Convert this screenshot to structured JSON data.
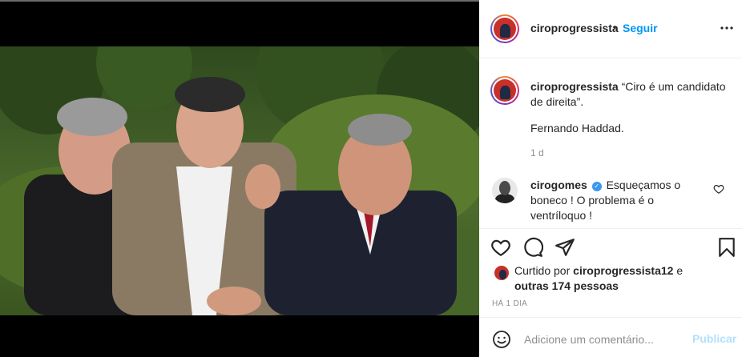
{
  "post": {
    "username": "ciroprogressista",
    "separator": "•",
    "follow_label": "Seguir",
    "more_label": "•••"
  },
  "caption": {
    "username": "ciroprogressista",
    "text": "“Ciro é um candidato de direita”.",
    "line2": "Fernando Haddad.",
    "time": "1 d"
  },
  "comment": {
    "username": "cirogomes",
    "text": "Esqueçamos o boneco ! O problema é o ventríloquo !"
  },
  "likes": {
    "prefix": "Curtido por ",
    "user": "ciroprogressista12",
    "middle": " e",
    "others": "outras 174 pessoas"
  },
  "date": "HÁ 1 DIA",
  "add_comment": {
    "placeholder": "Adicione um comentário...",
    "publish_label": "Publicar"
  },
  "icons": {
    "like": "heart-icon",
    "comment": "comment-icon",
    "share": "share-icon",
    "save": "bookmark-icon",
    "emoji": "emoji-icon",
    "options": "more-icon",
    "verified": "verified-icon"
  },
  "colors": {
    "link": "#0095f6",
    "publish_disabled": "#b2dffc",
    "muted": "#8e8e8e",
    "verified": "#3897f0"
  }
}
